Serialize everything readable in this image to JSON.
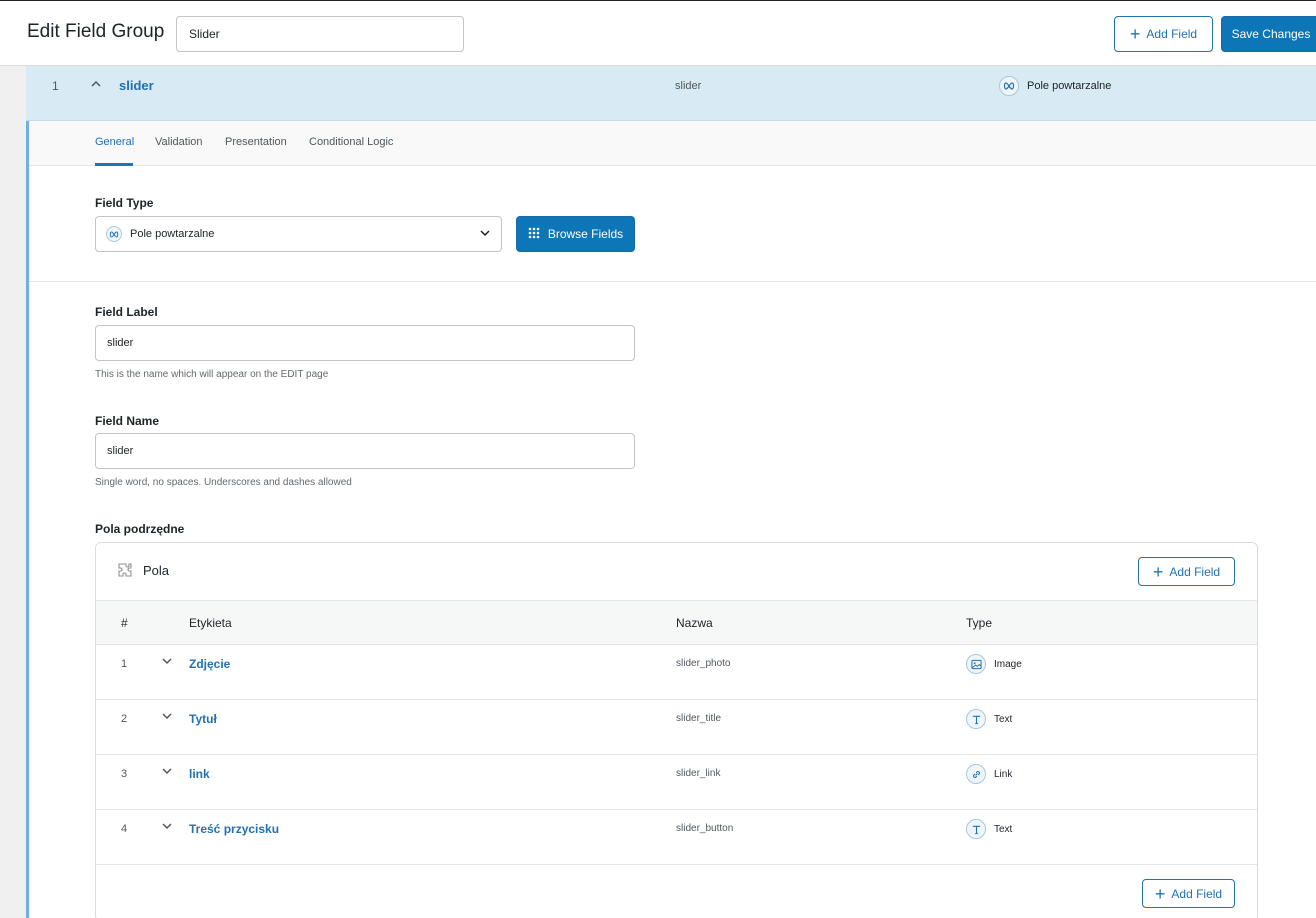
{
  "header": {
    "title": "Edit Field Group",
    "group_title_value": "Slider",
    "add_field_label": "Add Field",
    "save_label": "Save Changes"
  },
  "field": {
    "number": "1",
    "label": "slider",
    "name": "slider",
    "type": "Pole powtarzalne"
  },
  "tabs": [
    "General",
    "Validation",
    "Presentation",
    "Conditional Logic"
  ],
  "settings": {
    "field_type_label": "Field Type",
    "field_type_value": "Pole powtarzalne",
    "browse_fields_label": "Browse Fields",
    "field_label_label": "Field Label",
    "field_label_value": "slider",
    "field_label_hint": "This is the name which will appear on the EDIT page",
    "field_name_label": "Field Name",
    "field_name_value": "slider",
    "field_name_hint": "Single word, no spaces. Underscores and dashes allowed",
    "subfields_label": "Pola podrzędne"
  },
  "subfields": {
    "title": "Pola",
    "add_field_label": "Add Field",
    "columns": [
      "#",
      "Etykieta",
      "Nazwa",
      "Type"
    ],
    "rows": [
      {
        "num": "1",
        "label": "Zdjęcie",
        "name": "slider_photo",
        "type": "Image",
        "icon": "image-icon"
      },
      {
        "num": "2",
        "label": "Tytuł",
        "name": "slider_title",
        "type": "Text",
        "icon": "text-icon"
      },
      {
        "num": "3",
        "label": "link",
        "name": "slider_link",
        "type": "Link",
        "icon": "link-icon"
      },
      {
        "num": "4",
        "label": "Treść przycisku",
        "name": "slider_button",
        "type": "Text",
        "icon": "text-icon"
      }
    ],
    "footer_add_field_label": "Add Field"
  },
  "colors": {
    "accent": "#2271b1",
    "primary_button": "#0c76b7",
    "active_row": "#d8eaf3"
  }
}
